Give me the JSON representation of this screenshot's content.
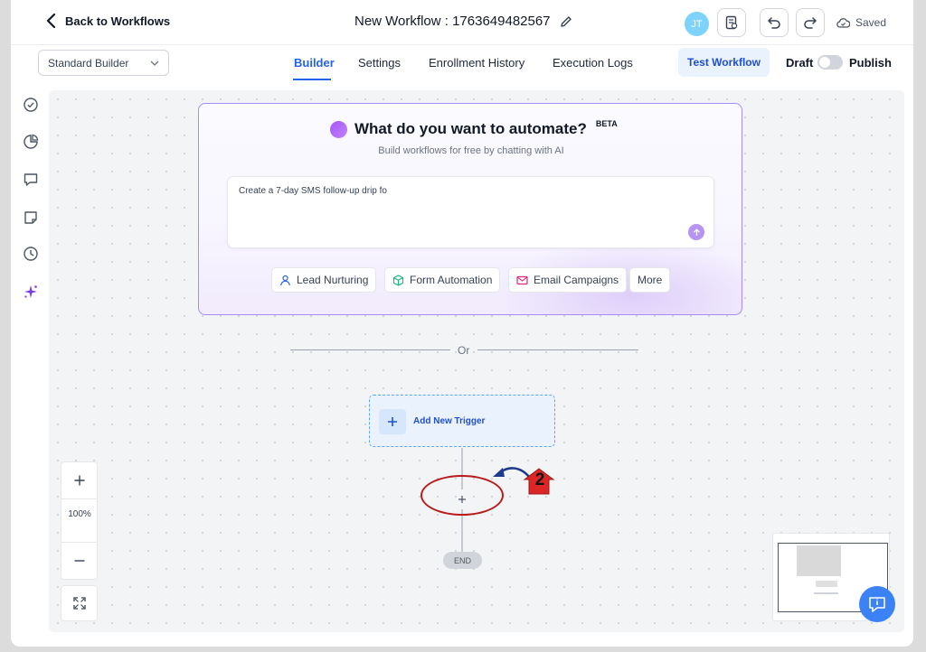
{
  "header": {
    "back_label": "Back to Workflows",
    "workflow_title": "New Workflow : 1763649482567",
    "avatar_initials": "JT",
    "saved_label": "Saved"
  },
  "subbar": {
    "builder_select": "Standard Builder",
    "tabs": [
      "Builder",
      "Settings",
      "Enrollment History",
      "Execution Logs"
    ],
    "active_tab": "Builder",
    "test_button": "Test Workflow",
    "draft_label": "Draft",
    "publish_label": "Publish",
    "publish_toggle_on": false
  },
  "sidebar": {
    "icons": [
      "check-circle-icon",
      "pie-chart-icon",
      "message-icon",
      "note-icon",
      "clock-icon",
      "sparkle-icon"
    ]
  },
  "ai_card": {
    "title": "What do you want to automate?",
    "badge": "BETA",
    "subtitle": "Build workflows for free by chatting with AI",
    "prompt_value": "Create a 7-day SMS follow-up drip fo",
    "chips": [
      "Lead Nurturing",
      "Form Automation",
      "Email Campaigns",
      "More"
    ]
  },
  "divider": {
    "text": "Or"
  },
  "flow": {
    "trigger_label": "Add New Trigger",
    "end_label": "END"
  },
  "annotation": {
    "number": "2"
  },
  "zoom": {
    "level": "100%"
  },
  "colors": {
    "accent_blue": "#2563eb",
    "ai_border": "#a78bfa",
    "annotation_red": "#b91c1c",
    "annotation_arrow": "#1e3a8a"
  }
}
